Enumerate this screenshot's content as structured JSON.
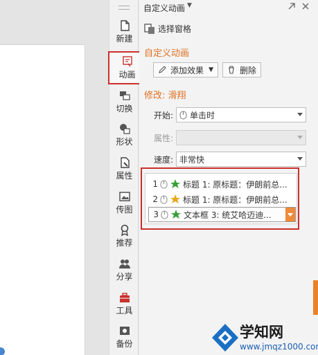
{
  "sidebar": {
    "items": [
      {
        "label": "新建",
        "icon": "new-doc-icon"
      },
      {
        "label": "动画",
        "icon": "animation-icon",
        "active": true
      },
      {
        "label": "切换",
        "icon": "transition-icon"
      },
      {
        "label": "形状",
        "icon": "shape-icon"
      },
      {
        "label": "属性",
        "icon": "properties-icon"
      },
      {
        "label": "传图",
        "icon": "upload-image-icon"
      },
      {
        "label": "推荐",
        "icon": "recommend-icon"
      },
      {
        "label": "分享",
        "icon": "share-icon"
      },
      {
        "label": "工具",
        "icon": "toolbox-icon"
      },
      {
        "label": "备份",
        "icon": "backup-icon"
      }
    ]
  },
  "panel": {
    "title": "自定义动画",
    "select_pane_label": "选择窗格",
    "section_custom_animation": "自定义动画",
    "add_effect_label": "添加效果",
    "delete_label": "删除",
    "modify_label": "修改: 滑翔",
    "start_label": "开始:",
    "start_value": "单击时",
    "property_label": "属性:",
    "property_value": "",
    "speed_label": "速度:",
    "speed_value": "非常快",
    "animation_list": [
      {
        "num": "1",
        "text": "标题 1: 原标题：伊朗前总..."
      },
      {
        "num": "2",
        "text": "标题 1: 原标题：伊朗前总..."
      },
      {
        "num": "3",
        "text": "文本框 3: 统艾哈迈迪..."
      }
    ]
  },
  "watermark": {
    "title": "学知网",
    "url": "www.jmqz1000.com"
  },
  "colors": {
    "accent_orange": "#e07020",
    "highlight_red": "#c9302c",
    "dropdown_orange": "#ef8a3a"
  }
}
